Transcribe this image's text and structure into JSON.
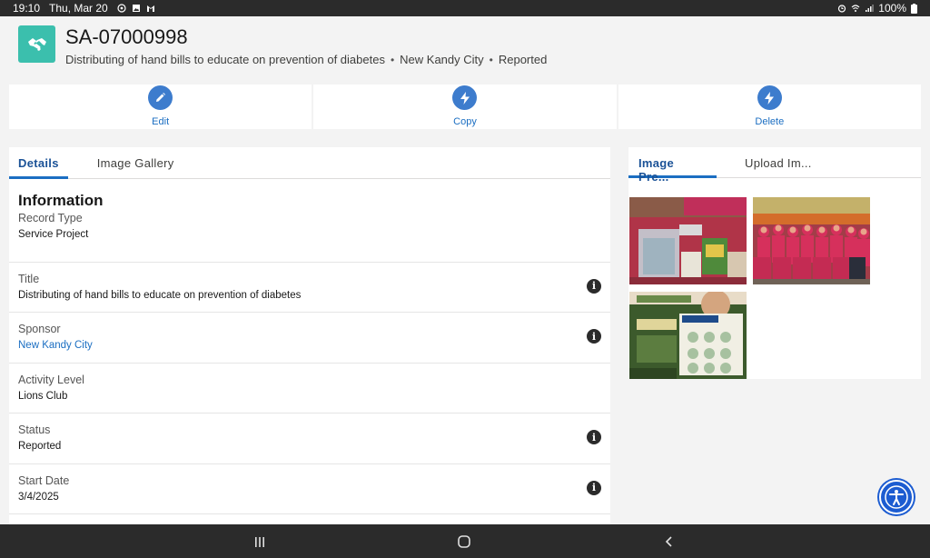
{
  "status_bar": {
    "time": "19:10",
    "date": "Thu, Mar 20",
    "battery": "100%",
    "left_icons": [
      "whatsapp-icon",
      "gallery-icon",
      "gmail-icon"
    ],
    "right_icons": [
      "alarm-icon",
      "wifi-icon",
      "signal-icon",
      "battery-icon"
    ]
  },
  "header": {
    "record_id": "SA-07000998",
    "subtitle_title": "Distributing of hand bills to educate on prevention of diabetes",
    "subtitle_sponsor": "New Kandy City",
    "subtitle_status": "Reported",
    "separator": "•",
    "icon": "handshake-icon",
    "icon_color": "#3bbfad"
  },
  "actions": [
    {
      "label": "Edit",
      "icon": "pencil-icon"
    },
    {
      "label": "Copy",
      "icon": "lightning-icon"
    },
    {
      "label": "Delete",
      "icon": "lightning-icon"
    }
  ],
  "main": {
    "tabs": [
      {
        "label": "Details",
        "active": true
      },
      {
        "label": "Image Gallery",
        "active": false
      }
    ],
    "section_title": "Information",
    "fields": [
      {
        "label": "Record Type",
        "value": "Service Project",
        "info": false
      },
      {
        "label": "Title",
        "value": "Distributing of hand bills to educate on prevention of diabetes",
        "info": true
      },
      {
        "label": "Sponsor",
        "value": "New Kandy City",
        "info": true,
        "link": true
      },
      {
        "label": "Activity Level",
        "value": "Lions Club",
        "info": false
      },
      {
        "label": "Status",
        "value": "Reported",
        "info": true
      },
      {
        "label": "Start Date",
        "value": "3/4/2025",
        "info": true
      }
    ],
    "info_glyph": "i"
  },
  "side": {
    "tabs": [
      {
        "label": "Image Pre...",
        "active": true
      },
      {
        "label": "Upload Im...",
        "active": false
      }
    ],
    "images": [
      "table-with-flyers-photo",
      "group-photo-red-shirts",
      "diabetes-flyer-photo"
    ]
  },
  "colors": {
    "accent": "#1b6ec2",
    "action_circle": "#3d7ccd",
    "page_bg": "#f3f3f3",
    "a11y_button": "#1c5cd1"
  }
}
